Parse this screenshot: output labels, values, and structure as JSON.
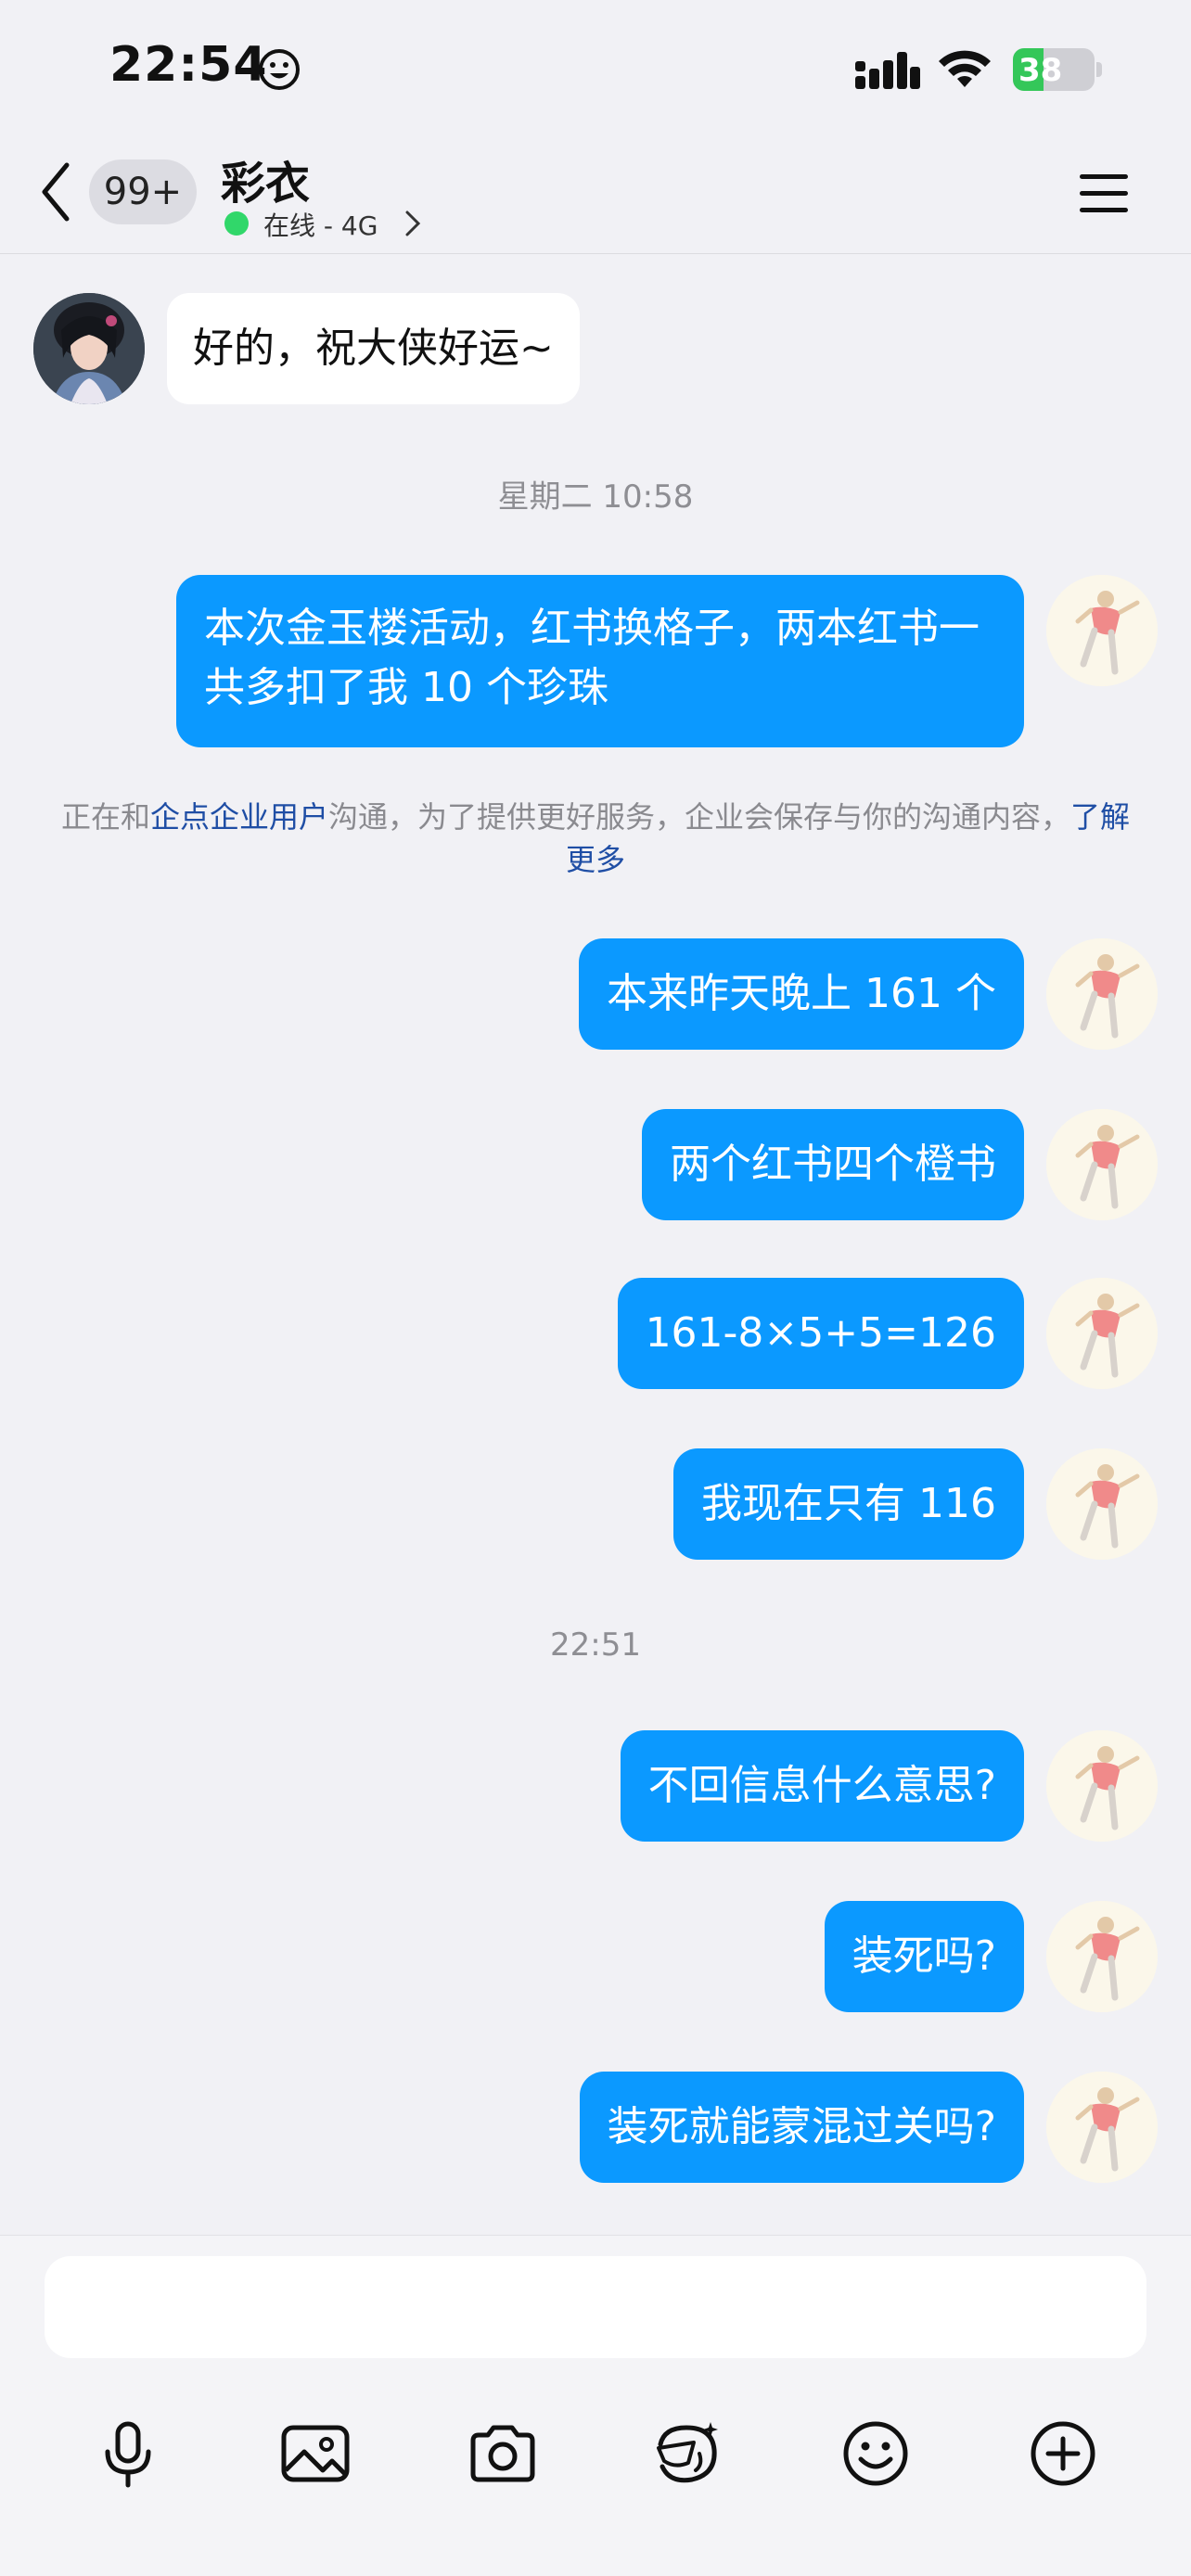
{
  "status_bar": {
    "time": "22:54",
    "battery": "38",
    "battery_level": 0.38
  },
  "nav": {
    "back_badge": "99+",
    "contact_name": "彩衣",
    "status_text": "在线 - 4G"
  },
  "messages": {
    "incoming_1": "好的，祝大侠好运~",
    "time_1": "星期二 10:58",
    "out_1": "本次金玉楼活动，红书换格子，两本红书一共多扣了我 10 个珍珠",
    "notice": {
      "prefix": "正在和",
      "company": "企点企业用户",
      "middle": "沟通，为了提供更好服务，企业会保存与你的沟通内容，",
      "link": "了解更多"
    },
    "out_2": "本来昨天晚上 161 个",
    "out_3": "两个红书四个橙书",
    "out_4": "161-8×5+5=126",
    "out_5": "我现在只有 116",
    "time_2": "22:51",
    "out_6": "不回信息什么意思?",
    "out_7": "装死吗?",
    "out_8": "装死就能蒙混过关吗?"
  },
  "input": {
    "placeholder": ""
  },
  "toolbar": {
    "icons": [
      "microphone-icon",
      "image-icon",
      "camera-icon",
      "sticker-icon",
      "emoji-icon",
      "plus-icon"
    ]
  },
  "colors": {
    "accent": "#0b99ff",
    "online": "#31d76a",
    "link": "#1f4ea5",
    "background": "#f1f1f5"
  }
}
